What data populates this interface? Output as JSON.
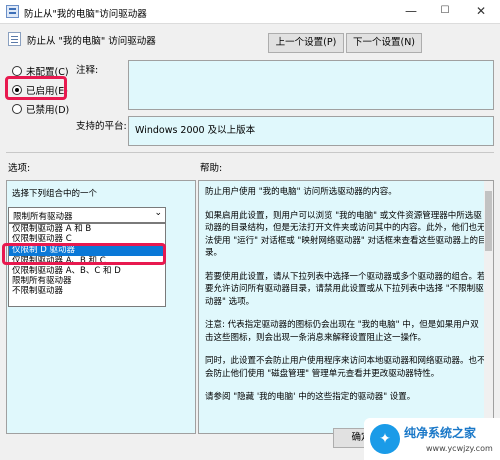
{
  "window": {
    "title": "防止从\"我的电脑\"访问驱动器",
    "min": "—",
    "max": "☐",
    "close": "✕"
  },
  "heading": "防止从 \"我的电脑\" 访问驱动器",
  "nav": {
    "prev": "上一个设置(P)",
    "next": "下一个设置(N)"
  },
  "radios": [
    {
      "label": "未配置(C)",
      "selected": false
    },
    {
      "label": "已启用(E)",
      "selected": true
    },
    {
      "label": "已禁用(D)",
      "selected": false
    }
  ],
  "labels": {
    "notes": "注释:",
    "platform": "支持的平台:",
    "options": "选项:",
    "help": "帮助:"
  },
  "platform_value": "Windows 2000 及以上版本",
  "options": {
    "prompt": "选择下列组合中的一个",
    "combo_value": "限制所有驱动器",
    "dropdown": [
      "仅限制驱动器 A 和 B",
      "仅限制驱动器 C",
      "仅限制 D 驱动器",
      "仅限制驱动器 A、B 和 C",
      "仅限制驱动器 A、B、C 和 D",
      "限制所有驱动器",
      "不限制驱动器"
    ],
    "selected_index": 2
  },
  "help": [
    "防止用户使用 \"我的电脑\" 访问所选驱动器的内容。",
    "如果启用此设置，则用户可以浏览 \"我的电脑\" 或文件资源管理器中所选驱动器的目录结构，但是无法打开文件夹或访问其中的内容。此外，他们也无法使用 \"运行\" 对话框或 \"映射网络驱动器\" 对话框来查看这些驱动器上的目录。",
    "若要使用此设置，请从下拉列表中选择一个驱动器或多个驱动器的组合。若要允许访问所有驱动器目录，请禁用此设置或从下拉列表中选择 \"不限制驱动器\" 选项。",
    "注意: 代表指定驱动器的图标仍会出现在 \"我的电脑\" 中，但是如果用户双击这些图标，则会出现一条消息来解释设置阻止这一操作。",
    "同时，此设置不会防止用户使用程序来访问本地驱动器和网络驱动器。也不会防止他们使用 \"磁盘管理\" 管理单元查看并更改驱动器特性。",
    "请参阅 \"隐藏 '我的电脑' 中的这些指定的驱动器\" 设置。"
  ],
  "buttons": {
    "ok": "确定"
  },
  "watermark": {
    "logo": "✦",
    "text": "纯净系统之家",
    "url": "www.ycwjzy.com"
  }
}
